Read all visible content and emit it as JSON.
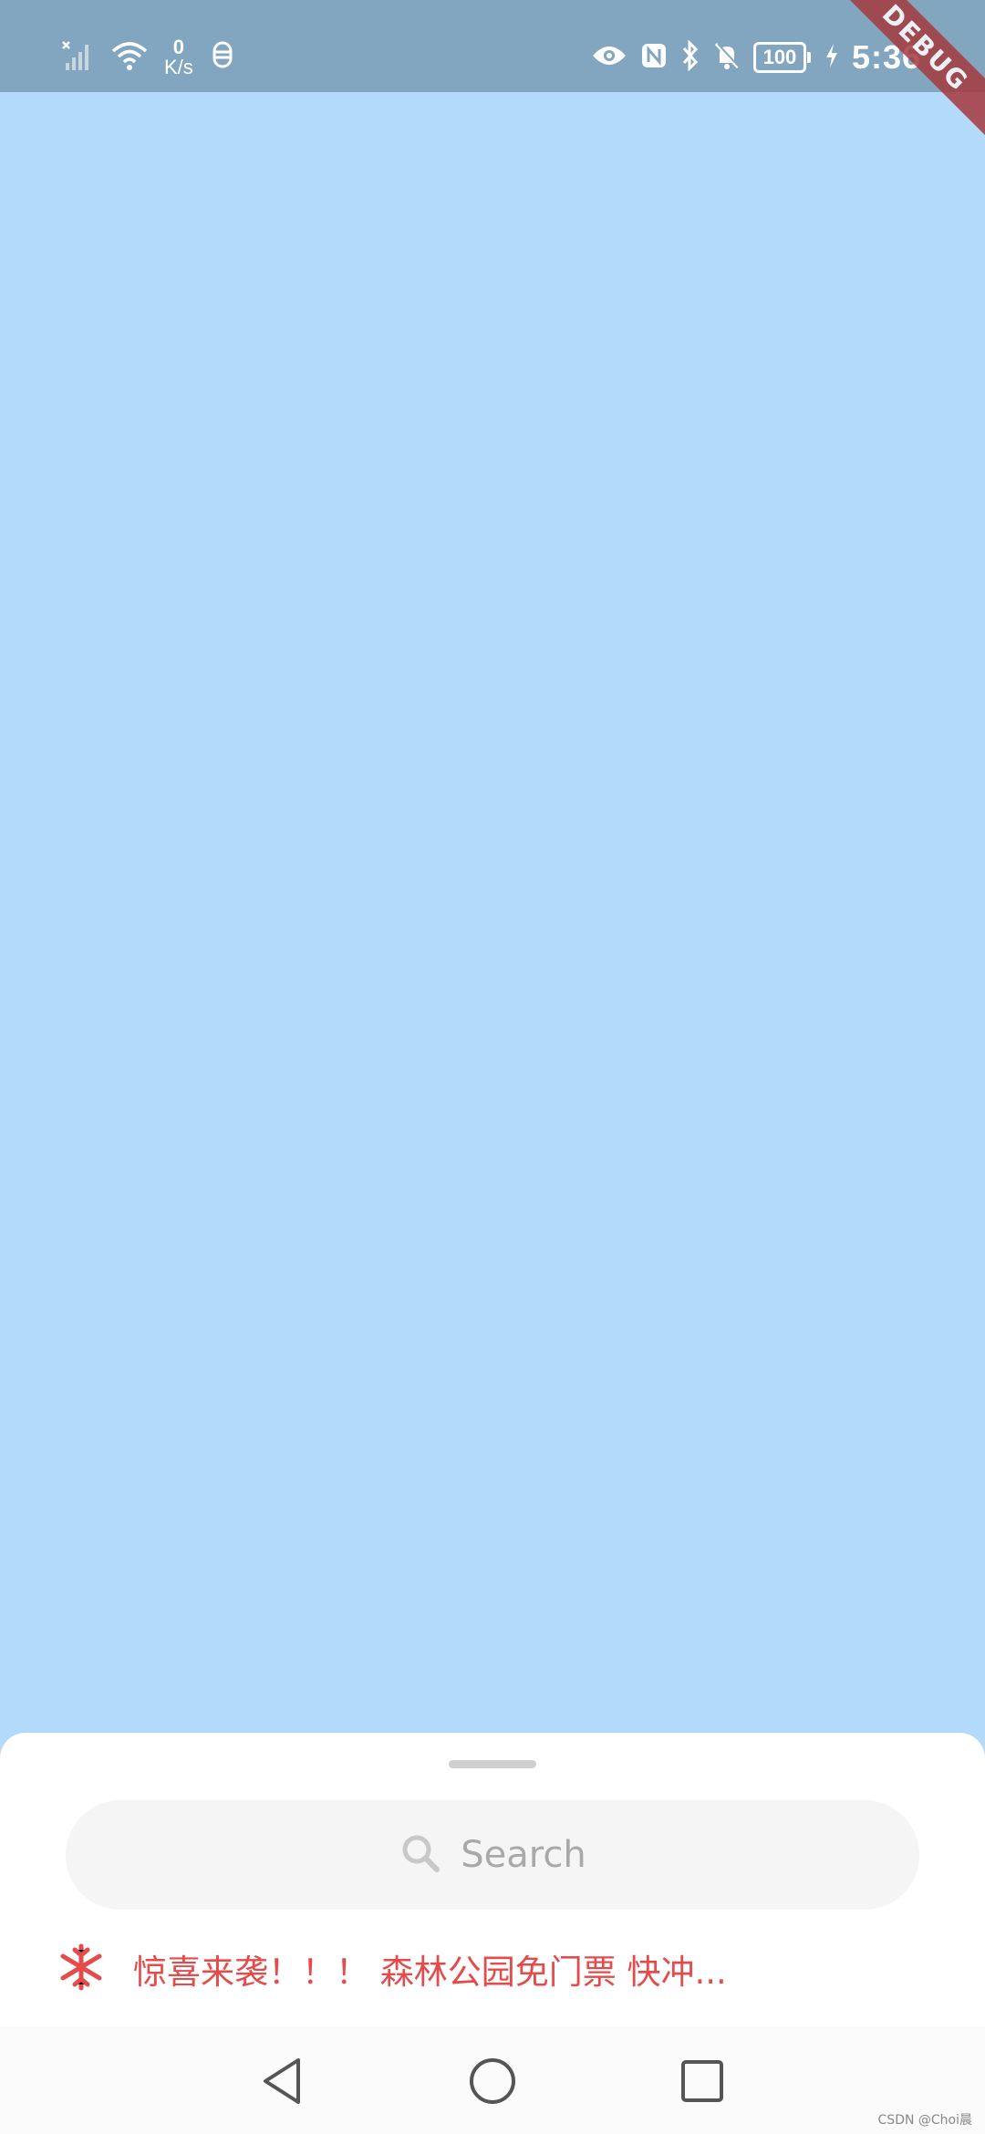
{
  "status_bar": {
    "net_speed_value": "0",
    "net_speed_unit": "K/s",
    "battery": "100",
    "time": "5:36",
    "icons": [
      "signal-off-icon",
      "wifi-icon",
      "notification-app-icon",
      "eye-icon",
      "nfc-icon",
      "bluetooth-icon",
      "bell-off-icon",
      "battery-icon",
      "charging-icon"
    ]
  },
  "debug_banner": "DEBUG",
  "bottom_sheet": {
    "search": {
      "placeholder": "Search",
      "icon": "search-icon"
    },
    "promo": {
      "icon": "snowflake-icon",
      "text": "惊喜来袭！！！ 森林公园免门票 快冲...",
      "color": "#e64b4b"
    }
  },
  "nav_bar": {
    "buttons": [
      "back-icon",
      "home-icon",
      "recents-icon"
    ]
  },
  "watermark": "CSDN @Choi晨",
  "colors": {
    "status_bar": "#83a6c0",
    "background": "#b3dafa",
    "sheet": "#ffffff",
    "search_bg": "#f5f5f5"
  }
}
